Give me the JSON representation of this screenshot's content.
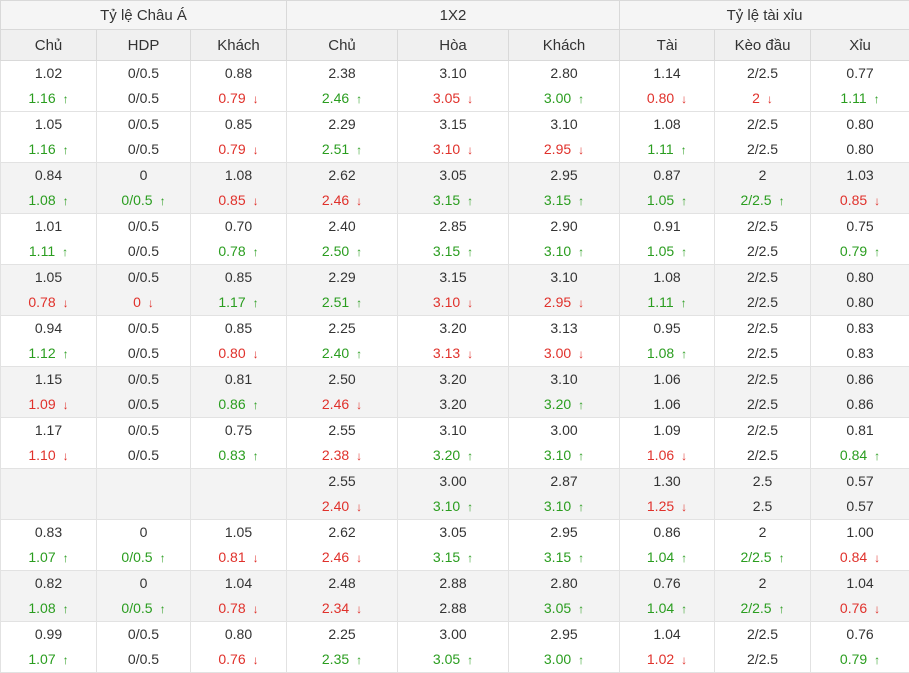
{
  "groups": [
    {
      "label": "Tỷ lệ Châu Á"
    },
    {
      "label": "1X2"
    },
    {
      "label": "Tỷ lệ tài xỉu"
    }
  ],
  "columns": [
    "Chủ",
    "HDP",
    "Khách",
    "Chủ",
    "Hòa",
    "Khách",
    "Tài",
    "Kèo đầu",
    "Xỉu"
  ],
  "colors": {
    "up": "#2a9d1f",
    "down": "#e0312b",
    "header_bg": "#f0f0f0",
    "row_shade": "#f3f3f3"
  },
  "icons": {
    "up": "arrow-up-icon",
    "down": "arrow-down-icon"
  },
  "rows": [
    {
      "shaded": false,
      "cells": [
        {
          "open": "1.02",
          "live": "1.16",
          "trend": "up"
        },
        {
          "open": "0/0.5",
          "live": "0/0.5",
          "trend": "same"
        },
        {
          "open": "0.88",
          "live": "0.79",
          "trend": "down"
        },
        {
          "open": "2.38",
          "live": "2.46",
          "trend": "up"
        },
        {
          "open": "3.10",
          "live": "3.05",
          "trend": "down"
        },
        {
          "open": "2.80",
          "live": "3.00",
          "trend": "up"
        },
        {
          "open": "1.14",
          "live": "0.80",
          "trend": "down"
        },
        {
          "open": "2/2.5",
          "live": "2",
          "trend": "down"
        },
        {
          "open": "0.77",
          "live": "1.11",
          "trend": "up"
        }
      ]
    },
    {
      "shaded": false,
      "cells": [
        {
          "open": "1.05",
          "live": "1.16",
          "trend": "up"
        },
        {
          "open": "0/0.5",
          "live": "0/0.5",
          "trend": "same"
        },
        {
          "open": "0.85",
          "live": "0.79",
          "trend": "down"
        },
        {
          "open": "2.29",
          "live": "2.51",
          "trend": "up"
        },
        {
          "open": "3.15",
          "live": "3.10",
          "trend": "down"
        },
        {
          "open": "3.10",
          "live": "2.95",
          "trend": "down"
        },
        {
          "open": "1.08",
          "live": "1.11",
          "trend": "up"
        },
        {
          "open": "2/2.5",
          "live": "2/2.5",
          "trend": "same"
        },
        {
          "open": "0.80",
          "live": "0.80",
          "trend": "same"
        }
      ]
    },
    {
      "shaded": true,
      "cells": [
        {
          "open": "0.84",
          "live": "1.08",
          "trend": "up"
        },
        {
          "open": "0",
          "live": "0/0.5",
          "trend": "up"
        },
        {
          "open": "1.08",
          "live": "0.85",
          "trend": "down"
        },
        {
          "open": "2.62",
          "live": "2.46",
          "trend": "down"
        },
        {
          "open": "3.05",
          "live": "3.15",
          "trend": "up"
        },
        {
          "open": "2.95",
          "live": "3.15",
          "trend": "up"
        },
        {
          "open": "0.87",
          "live": "1.05",
          "trend": "up"
        },
        {
          "open": "2",
          "live": "2/2.5",
          "trend": "up"
        },
        {
          "open": "1.03",
          "live": "0.85",
          "trend": "down"
        }
      ]
    },
    {
      "shaded": false,
      "cells": [
        {
          "open": "1.01",
          "live": "1.11",
          "trend": "up"
        },
        {
          "open": "0/0.5",
          "live": "0/0.5",
          "trend": "same"
        },
        {
          "open": "0.70",
          "live": "0.78",
          "trend": "up"
        },
        {
          "open": "2.40",
          "live": "2.50",
          "trend": "up"
        },
        {
          "open": "2.85",
          "live": "3.15",
          "trend": "up"
        },
        {
          "open": "2.90",
          "live": "3.10",
          "trend": "up"
        },
        {
          "open": "0.91",
          "live": "1.05",
          "trend": "up"
        },
        {
          "open": "2/2.5",
          "live": "2/2.5",
          "trend": "same"
        },
        {
          "open": "0.75",
          "live": "0.79",
          "trend": "up"
        }
      ]
    },
    {
      "shaded": true,
      "cells": [
        {
          "open": "1.05",
          "live": "0.78",
          "trend": "down"
        },
        {
          "open": "0/0.5",
          "live": "0",
          "trend": "down"
        },
        {
          "open": "0.85",
          "live": "1.17",
          "trend": "up"
        },
        {
          "open": "2.29",
          "live": "2.51",
          "trend": "up"
        },
        {
          "open": "3.15",
          "live": "3.10",
          "trend": "down"
        },
        {
          "open": "3.10",
          "live": "2.95",
          "trend": "down"
        },
        {
          "open": "1.08",
          "live": "1.11",
          "trend": "up"
        },
        {
          "open": "2/2.5",
          "live": "2/2.5",
          "trend": "same"
        },
        {
          "open": "0.80",
          "live": "0.80",
          "trend": "same"
        }
      ]
    },
    {
      "shaded": false,
      "cells": [
        {
          "open": "0.94",
          "live": "1.12",
          "trend": "up"
        },
        {
          "open": "0/0.5",
          "live": "0/0.5",
          "trend": "same"
        },
        {
          "open": "0.85",
          "live": "0.80",
          "trend": "down"
        },
        {
          "open": "2.25",
          "live": "2.40",
          "trend": "up"
        },
        {
          "open": "3.20",
          "live": "3.13",
          "trend": "down"
        },
        {
          "open": "3.13",
          "live": "3.00",
          "trend": "down"
        },
        {
          "open": "0.95",
          "live": "1.08",
          "trend": "up"
        },
        {
          "open": "2/2.5",
          "live": "2/2.5",
          "trend": "same"
        },
        {
          "open": "0.83",
          "live": "0.83",
          "trend": "same"
        }
      ]
    },
    {
      "shaded": true,
      "cells": [
        {
          "open": "1.15",
          "live": "1.09",
          "trend": "down"
        },
        {
          "open": "0/0.5",
          "live": "0/0.5",
          "trend": "same"
        },
        {
          "open": "0.81",
          "live": "0.86",
          "trend": "up"
        },
        {
          "open": "2.50",
          "live": "2.46",
          "trend": "down"
        },
        {
          "open": "3.20",
          "live": "3.20",
          "trend": "same"
        },
        {
          "open": "3.10",
          "live": "3.20",
          "trend": "up"
        },
        {
          "open": "1.06",
          "live": "1.06",
          "trend": "same"
        },
        {
          "open": "2/2.5",
          "live": "2/2.5",
          "trend": "same"
        },
        {
          "open": "0.86",
          "live": "0.86",
          "trend": "same"
        }
      ]
    },
    {
      "shaded": false,
      "cells": [
        {
          "open": "1.17",
          "live": "1.10",
          "trend": "down"
        },
        {
          "open": "0/0.5",
          "live": "0/0.5",
          "trend": "same"
        },
        {
          "open": "0.75",
          "live": "0.83",
          "trend": "up"
        },
        {
          "open": "2.55",
          "live": "2.38",
          "trend": "down"
        },
        {
          "open": "3.10",
          "live": "3.20",
          "trend": "up"
        },
        {
          "open": "3.00",
          "live": "3.10",
          "trend": "up"
        },
        {
          "open": "1.09",
          "live": "1.06",
          "trend": "down"
        },
        {
          "open": "2/2.5",
          "live": "2/2.5",
          "trend": "same"
        },
        {
          "open": "0.81",
          "live": "0.84",
          "trend": "up"
        }
      ]
    },
    {
      "shaded": true,
      "cells": [
        {
          "open": "",
          "live": "",
          "trend": "none"
        },
        {
          "open": "",
          "live": "",
          "trend": "none"
        },
        {
          "open": "",
          "live": "",
          "trend": "none"
        },
        {
          "open": "2.55",
          "live": "2.40",
          "trend": "down"
        },
        {
          "open": "3.00",
          "live": "3.10",
          "trend": "up"
        },
        {
          "open": "2.87",
          "live": "3.10",
          "trend": "up"
        },
        {
          "open": "1.30",
          "live": "1.25",
          "trend": "down"
        },
        {
          "open": "2.5",
          "live": "2.5",
          "trend": "same"
        },
        {
          "open": "0.57",
          "live": "0.57",
          "trend": "same"
        }
      ]
    },
    {
      "shaded": false,
      "cells": [
        {
          "open": "0.83",
          "live": "1.07",
          "trend": "up"
        },
        {
          "open": "0",
          "live": "0/0.5",
          "trend": "up"
        },
        {
          "open": "1.05",
          "live": "0.81",
          "trend": "down"
        },
        {
          "open": "2.62",
          "live": "2.46",
          "trend": "down"
        },
        {
          "open": "3.05",
          "live": "3.15",
          "trend": "up"
        },
        {
          "open": "2.95",
          "live": "3.15",
          "trend": "up"
        },
        {
          "open": "0.86",
          "live": "1.04",
          "trend": "up"
        },
        {
          "open": "2",
          "live": "2/2.5",
          "trend": "up"
        },
        {
          "open": "1.00",
          "live": "0.84",
          "trend": "down"
        }
      ]
    },
    {
      "shaded": true,
      "cells": [
        {
          "open": "0.82",
          "live": "1.08",
          "trend": "up"
        },
        {
          "open": "0",
          "live": "0/0.5",
          "trend": "up"
        },
        {
          "open": "1.04",
          "live": "0.78",
          "trend": "down"
        },
        {
          "open": "2.48",
          "live": "2.34",
          "trend": "down"
        },
        {
          "open": "2.88",
          "live": "2.88",
          "trend": "same"
        },
        {
          "open": "2.80",
          "live": "3.05",
          "trend": "up"
        },
        {
          "open": "0.76",
          "live": "1.04",
          "trend": "up"
        },
        {
          "open": "2",
          "live": "2/2.5",
          "trend": "up"
        },
        {
          "open": "1.04",
          "live": "0.76",
          "trend": "down"
        }
      ]
    },
    {
      "shaded": false,
      "cells": [
        {
          "open": "0.99",
          "live": "1.07",
          "trend": "up"
        },
        {
          "open": "0/0.5",
          "live": "0/0.5",
          "trend": "same"
        },
        {
          "open": "0.80",
          "live": "0.76",
          "trend": "down"
        },
        {
          "open": "2.25",
          "live": "2.35",
          "trend": "up"
        },
        {
          "open": "3.00",
          "live": "3.05",
          "trend": "up"
        },
        {
          "open": "2.95",
          "live": "3.00",
          "trend": "up"
        },
        {
          "open": "1.04",
          "live": "1.02",
          "trend": "down"
        },
        {
          "open": "2/2.5",
          "live": "2/2.5",
          "trend": "same"
        },
        {
          "open": "0.76",
          "live": "0.79",
          "trend": "up"
        }
      ]
    }
  ]
}
